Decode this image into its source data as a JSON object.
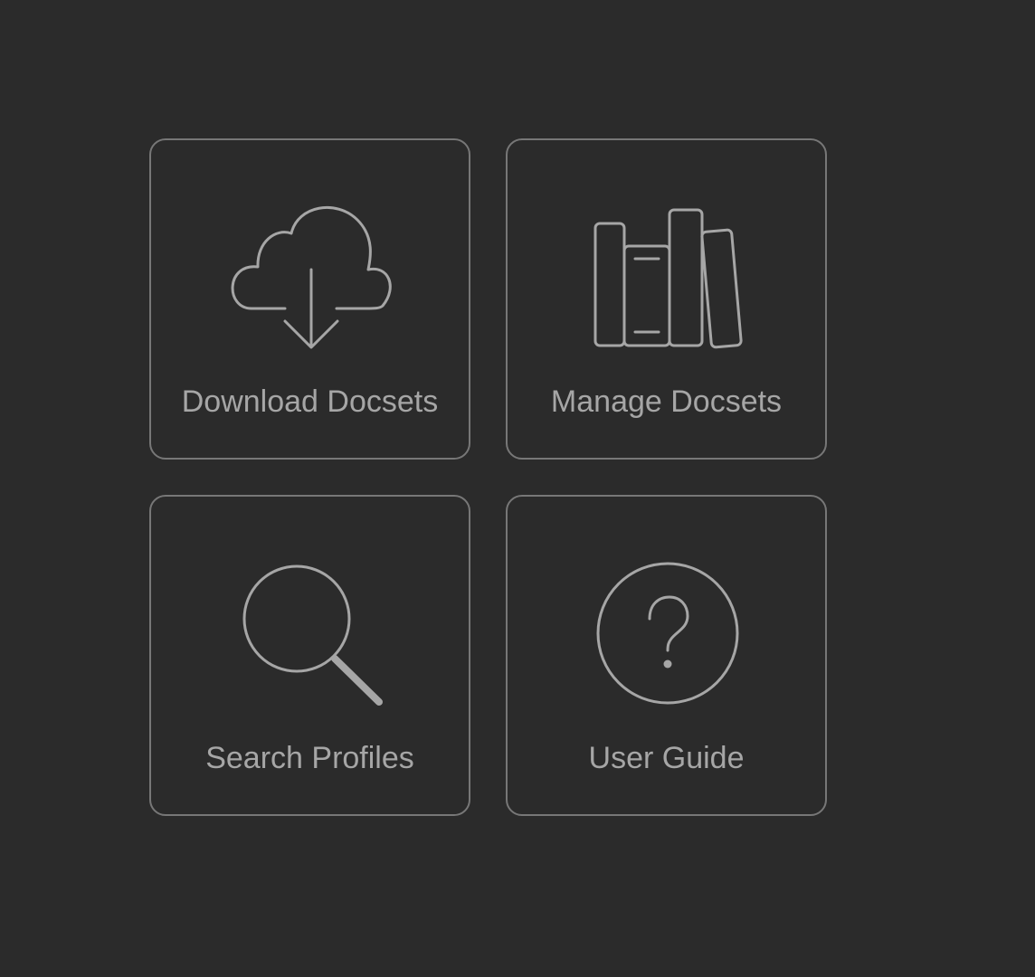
{
  "tiles": [
    {
      "label": "Download Docsets",
      "icon": "cloud-download-icon"
    },
    {
      "label": "Manage Docsets",
      "icon": "books-icon"
    },
    {
      "label": "Search Profiles",
      "icon": "magnifier-icon"
    },
    {
      "label": "User Guide",
      "icon": "question-circle-icon"
    }
  ],
  "colors": {
    "background": "#2b2b2b",
    "tile_border": "#777777",
    "foreground": "#a6a6a6"
  }
}
